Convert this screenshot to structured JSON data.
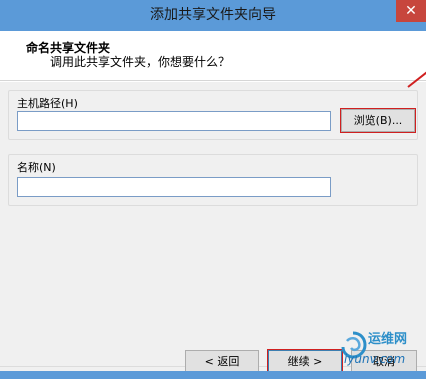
{
  "window": {
    "title": "添加共享文件夹向导",
    "close_glyph": "✕"
  },
  "header": {
    "title": "命名共享文件夹",
    "subtitle": "调用此共享文件夹，你想要什么？"
  },
  "host_path": {
    "label": "主机路径(H)",
    "value": "",
    "browse_label": "浏览(B)..."
  },
  "name_field": {
    "label": "名称(N)",
    "value": ""
  },
  "footer": {
    "back_label": "< 返回",
    "next_label": "继续 >",
    "cancel_label": "取消"
  },
  "watermark": {
    "line1": "运维网",
    "line2": "iyunv.com"
  },
  "colors": {
    "titlebar": "#5b9ad8",
    "close_button": "#c7463d",
    "highlight": "#d02020"
  }
}
